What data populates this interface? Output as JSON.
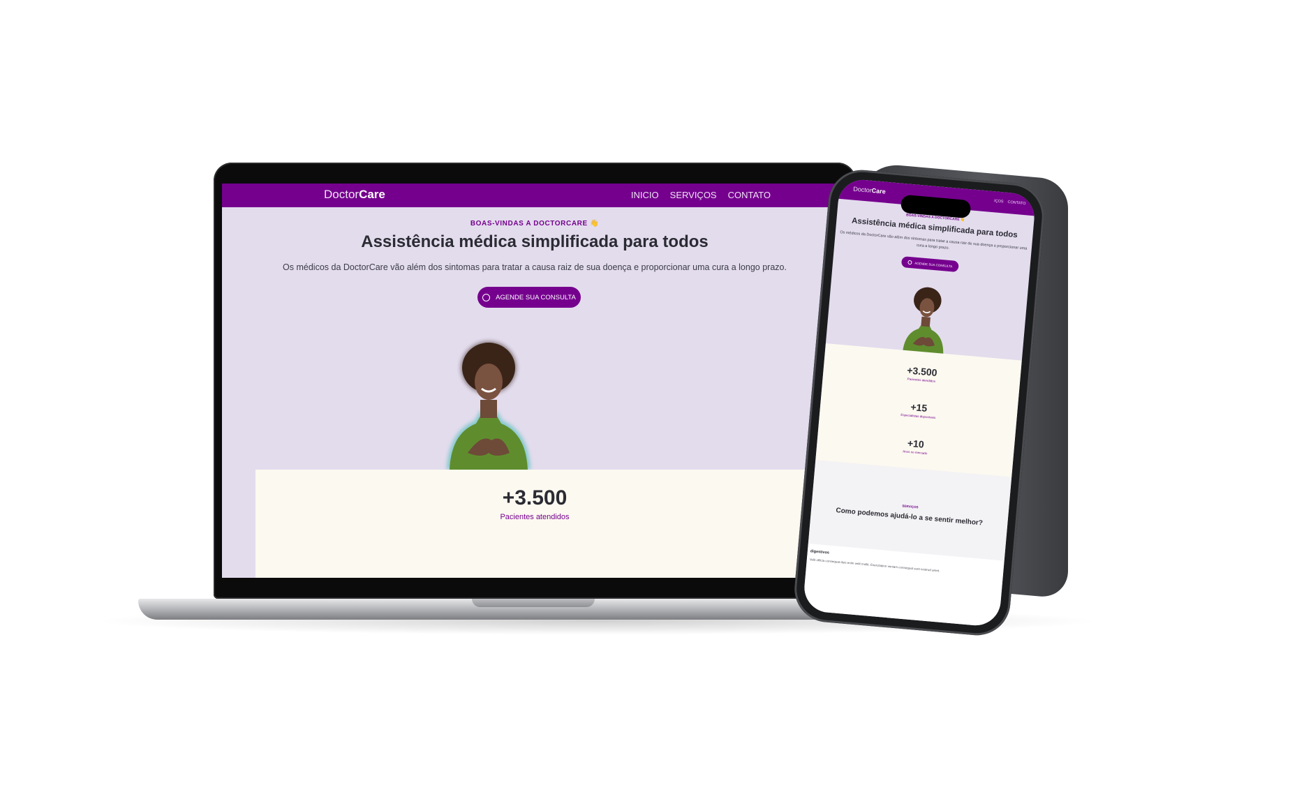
{
  "site": {
    "logo_light": "Doctor",
    "logo_bold": "Care",
    "nav": [
      "INICIO",
      "SERVIÇOS",
      "CONTATO"
    ],
    "tagline": "BOAS-VINDAS A DOCTORCARE 👋",
    "title": "Assistência médica simplificada para todos",
    "subtitle": "Os médicos da DoctorCare vão além dos sintomas para tratar a causa raiz de sua doença e proporcionar uma cura a longo prazo.",
    "cta": "AGENDE SUA CONSULTA",
    "stats": [
      {
        "value": "+3.500",
        "label": "Pacientes atendidos"
      },
      {
        "value": "+15",
        "label": "Especialistas disponíveis"
      },
      {
        "value": "+10",
        "label": "Anos no mercado"
      }
    ],
    "services_tag": "SERVIÇOS",
    "services_title": "Como podemos ajudá-lo a se sentir melhor?",
    "phone_nav": [
      "IÇOS",
      "CONTATO"
    ],
    "card_title": "digestivos",
    "card_text": "Velit officia consequat duis enim velit mollit. Exercitation veniam consequat sunt nostrud amet."
  },
  "colors": {
    "brand": "#75008e",
    "hero_bg": "#e3dced",
    "stats_bg": "#fcf9f0",
    "heading": "#2b2b33"
  },
  "icons": {
    "cta_icon": "whatsapp-icon"
  }
}
